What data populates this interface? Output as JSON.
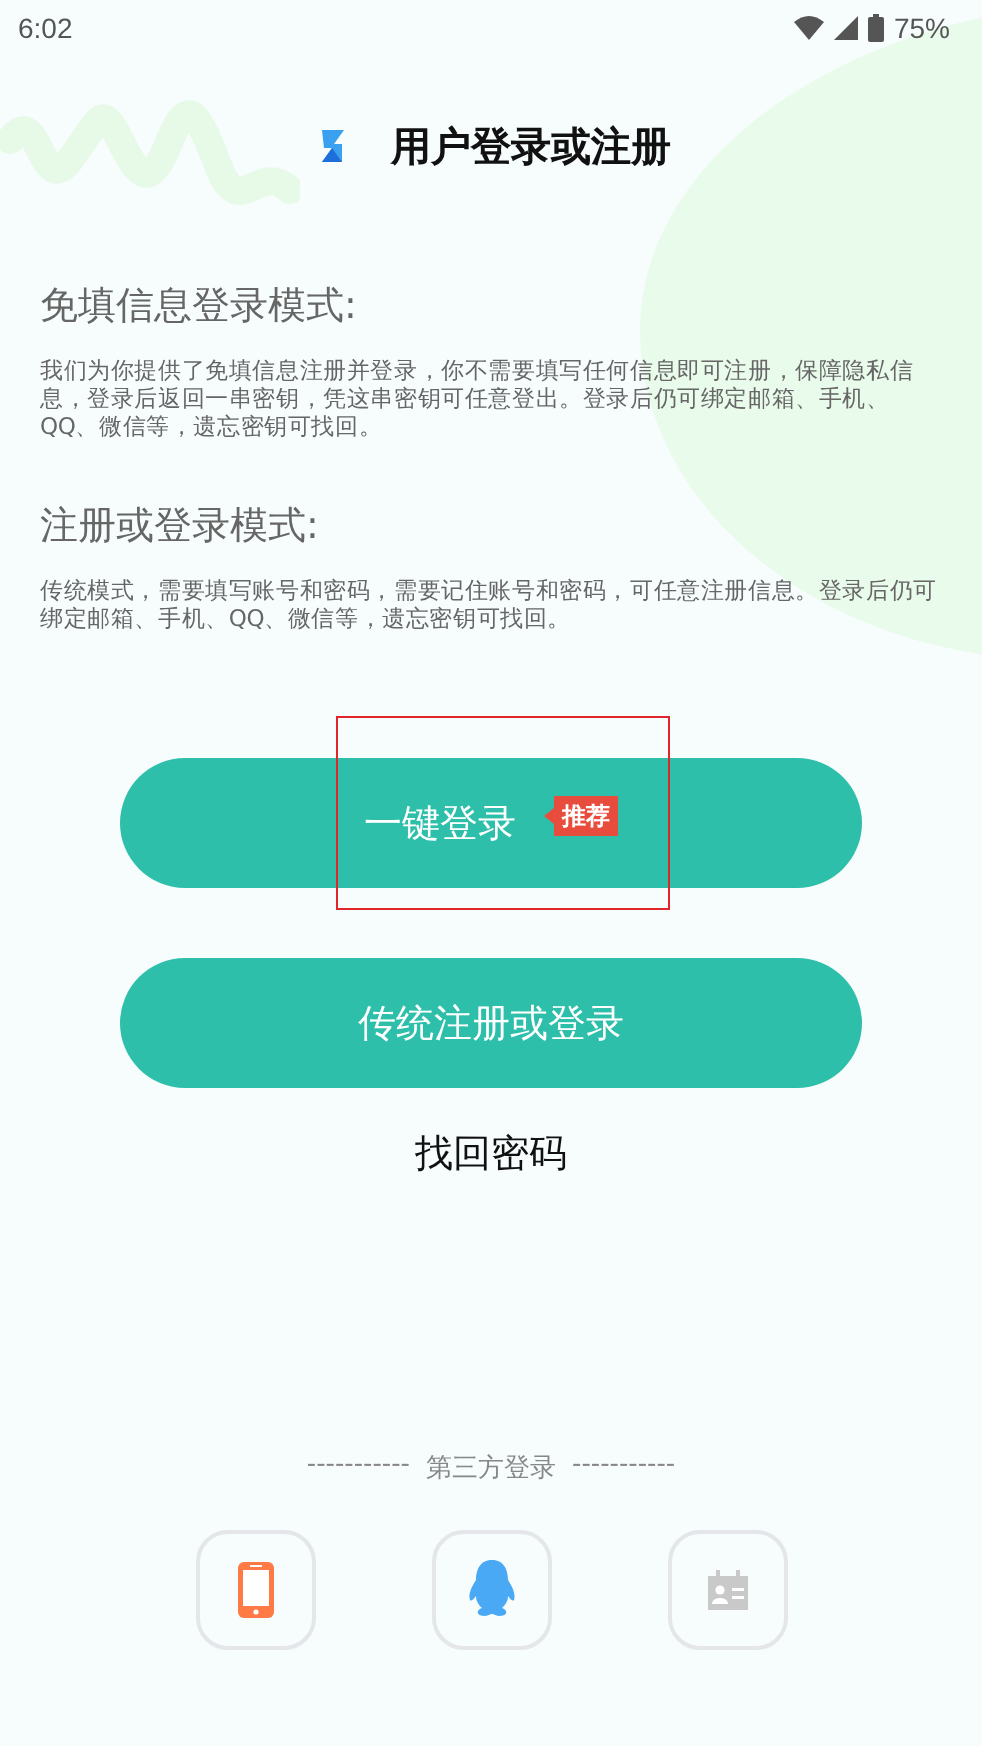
{
  "status_bar": {
    "time": "6:02",
    "battery": "75%"
  },
  "header": {
    "title": "用户登录或注册"
  },
  "sections": [
    {
      "heading": "免填信息登录模式:",
      "text": "我们为你提供了免填信息注册并登录，你不需要填写任何信息即可注册，保障隐私信息，登录后返回一串密钥，凭这串密钥可任意登出。登录后仍可绑定邮箱、手机、QQ、微信等，遗忘密钥可找回。"
    },
    {
      "heading": "注册或登录模式:",
      "text": "传统模式，需要填写账号和密码，需要记住账号和密码，可任意注册信息。登录后仍可绑定邮箱、手机、QQ、微信等，遗忘密钥可找回。"
    }
  ],
  "buttons": [
    {
      "label": "一键登录",
      "badge": "推荐",
      "highlighted": true
    },
    {
      "label": "传统注册或登录",
      "highlighted": false
    }
  ],
  "recover_link": "找回密码",
  "third_party": {
    "left_rule": "-----------",
    "label": "第三方登录",
    "right_rule": "-----------",
    "options": [
      {
        "kind": "phone"
      },
      {
        "kind": "qq"
      },
      {
        "kind": "card"
      }
    ]
  }
}
